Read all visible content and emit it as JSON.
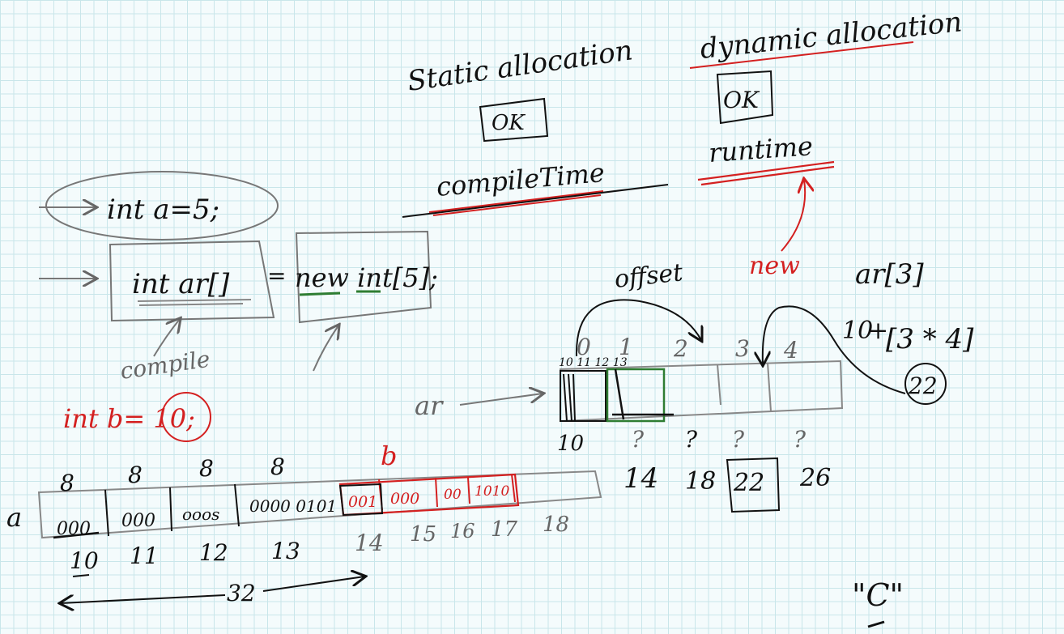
{
  "headings": {
    "static": "Static allocation",
    "static_ok": "OK",
    "compile_time": "compileTime",
    "dynamic": "dynamic allocation",
    "dynamic_ok": "OK",
    "runtime": "runtime",
    "new_label": "new",
    "offset": "offset",
    "ar_index": "ar[3]"
  },
  "code": {
    "line1": "int a=5;",
    "line2_left": "int ar[]",
    "line2_eq": "=",
    "line2_right": "new int[5];",
    "compile_note": "compile",
    "red_line": "int b= 10;"
  },
  "memory_a": {
    "var": "a",
    "sizes": [
      "8",
      "8",
      "8",
      "8"
    ],
    "cells": [
      "000",
      "000",
      "ooos",
      "0000 0101"
    ],
    "red_size": "b",
    "red_cells": [
      "001",
      "000",
      "00",
      "1010"
    ],
    "addresses": [
      "10",
      "11",
      "12",
      "13"
    ],
    "red_addresses": [
      "14",
      "15",
      "16",
      "17",
      "18"
    ],
    "span": "32"
  },
  "array": {
    "var": "ar",
    "indices": [
      "0",
      "1",
      "2",
      "3",
      "4"
    ],
    "byte_labels": "10 11 12 13",
    "unknown": [
      "?",
      "?",
      "?",
      "?"
    ],
    "addresses": [
      "10",
      "14",
      "18",
      "22",
      "26"
    ],
    "formula_base": "10",
    "formula_plus": "+",
    "formula_expr": "[3 * 4]",
    "formula_result": "22"
  },
  "footer": {
    "c_label": "\"C\""
  },
  "colors": {
    "ink": "#111111",
    "red": "#d42020",
    "green": "#2e7d32",
    "grey": "#666666"
  }
}
